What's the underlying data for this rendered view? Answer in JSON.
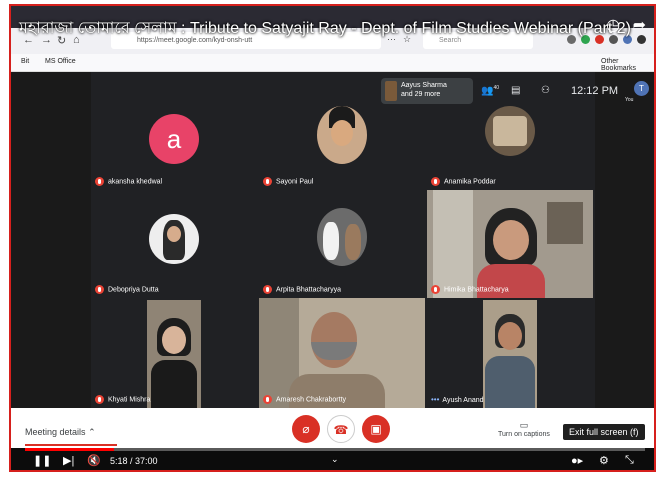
{
  "overlay": {
    "title": "মহারাজা তোমারে সেলাম : Tribute to Satyajit Ray - Dept. of Film Studies Webinar (Part 2)"
  },
  "browser": {
    "url": "https://meet.google.com/kyd-onsh-utt",
    "search_placeholder": "Search",
    "bookmarks": [
      "Bit",
      "MS Office"
    ],
    "other_bookmarks": "Other Bookmarks"
  },
  "meet": {
    "people_chip": {
      "line1": "Aayus Sharma",
      "line2": "and 29 more",
      "count": "40"
    },
    "clock": "12:12 PM",
    "self_initial": "T",
    "self_label": "You",
    "participants": [
      {
        "name": "akansha khedwal",
        "avatar": "a"
      },
      {
        "name": "Sayoni Paul"
      },
      {
        "name": "Anamika Poddar"
      },
      {
        "name": "Debopriya Dutta"
      },
      {
        "name": "Arpita Bhattacharyya"
      },
      {
        "name": "Himika Bhattacharya"
      },
      {
        "name": "Khyati Mishra"
      },
      {
        "name": "Amaresh Chakrabortty"
      },
      {
        "name": "Ayush Anand"
      }
    ],
    "colors": {
      "accent_red": "#ea4335",
      "avatar_pink": "#e84368"
    }
  },
  "controls": {
    "meeting_details": "Meeting details",
    "turn_on_captions": "Turn on captions",
    "present_now": "Present now",
    "tooltip": "Exit full screen (f)"
  },
  "player": {
    "time": "5:18 / 37:00",
    "progress": 0.143
  }
}
